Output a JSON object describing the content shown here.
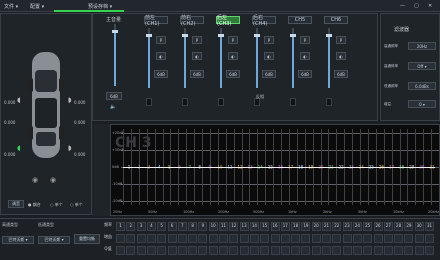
{
  "topbar": {
    "menus": [
      "文件 ▾",
      "配置 ▾",
      "预设存档 ▾"
    ],
    "window": [
      "—",
      "▢",
      "✕"
    ]
  },
  "car": {
    "left_vals": [
      "0.000",
      "0.000",
      "0.000"
    ],
    "right_vals": [
      "0.000",
      "0.000",
      "0.000"
    ],
    "reset_label": "调音",
    "radio": [
      "● 耦合",
      "○ 单个",
      "○ 单个"
    ]
  },
  "mixer": {
    "master": {
      "label": "主音量",
      "db": "6dB"
    },
    "channels": [
      {
        "label": "前左(CH1)",
        "db": "6dB",
        "active": false
      },
      {
        "label": "前右(CH2)",
        "db": "6dB",
        "active": false
      },
      {
        "label": "后左(CH3)",
        "db": "6dB",
        "active": true
      },
      {
        "label": "后右(CH4)",
        "db": "6dB",
        "active": false
      },
      {
        "label": "CH5",
        "db": "6dB",
        "active": false
      },
      {
        "label": "CH6",
        "db": "6dB",
        "active": false
      }
    ],
    "phase_label": "反相"
  },
  "xover": {
    "title": "滤波器",
    "rows": [
      {
        "label": "高通频率",
        "value": "20Hz"
      },
      {
        "label": "高通斜率",
        "value": "Off ▾"
      },
      {
        "label": "低通频率",
        "value": "6.0dBs"
      },
      {
        "label": "增益",
        "value": "0 ▾"
      }
    ]
  },
  "plot": {
    "watermark": "CH 3",
    "y_labels": [
      "+20dB",
      "+10dB",
      "0dB",
      "-10dB",
      "-20dB"
    ],
    "x_labels": [
      "20Hz",
      "50Hz",
      "100Hz",
      "200Hz",
      "500Hz",
      "1kHz",
      "2kHz",
      "5kHz",
      "10kHz",
      "20kHz"
    ],
    "points": [
      "1",
      "2",
      "3",
      "4",
      "5",
      "6",
      "7",
      "8",
      "9",
      "10",
      "11",
      "12",
      "13",
      "14",
      "15",
      "16",
      "17",
      "18",
      "19",
      "20",
      "21",
      "22",
      "23",
      "24",
      "25",
      "26",
      "27",
      "28",
      "29",
      "30",
      "31"
    ]
  },
  "bottom": {
    "label1": "高通类型",
    "label2": "低通类型",
    "sel1": "巴特沃斯 ▾",
    "sel2": "巴特沃斯 ▾",
    "reset": "重置均衡",
    "rows": [
      "频率",
      "增益",
      "Q值"
    ],
    "cols": [
      "1",
      "2",
      "3",
      "4",
      "5",
      "6",
      "7",
      "8",
      "9",
      "10",
      "11",
      "12",
      "13",
      "14",
      "15",
      "16",
      "17",
      "18",
      "19",
      "20",
      "21",
      "22",
      "23",
      "24",
      "25",
      "26",
      "27",
      "28",
      "29",
      "30",
      "31"
    ]
  }
}
